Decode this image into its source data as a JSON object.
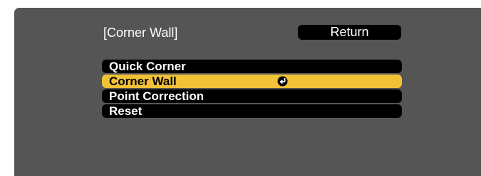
{
  "menu": {
    "title": "[Corner Wall]",
    "return_label": "Return",
    "items": [
      {
        "label": "Quick Corner",
        "selected": false
      },
      {
        "label": "Corner Wall",
        "selected": true,
        "icon": "enter-icon"
      },
      {
        "label": "Point Correction",
        "selected": false
      },
      {
        "label": "Reset",
        "selected": false
      }
    ]
  },
  "colors": {
    "panel_background": "#555555",
    "item_background": "#000000",
    "selected_background": "#f2c236",
    "text": "#ffffff",
    "selected_text": "#000000"
  }
}
